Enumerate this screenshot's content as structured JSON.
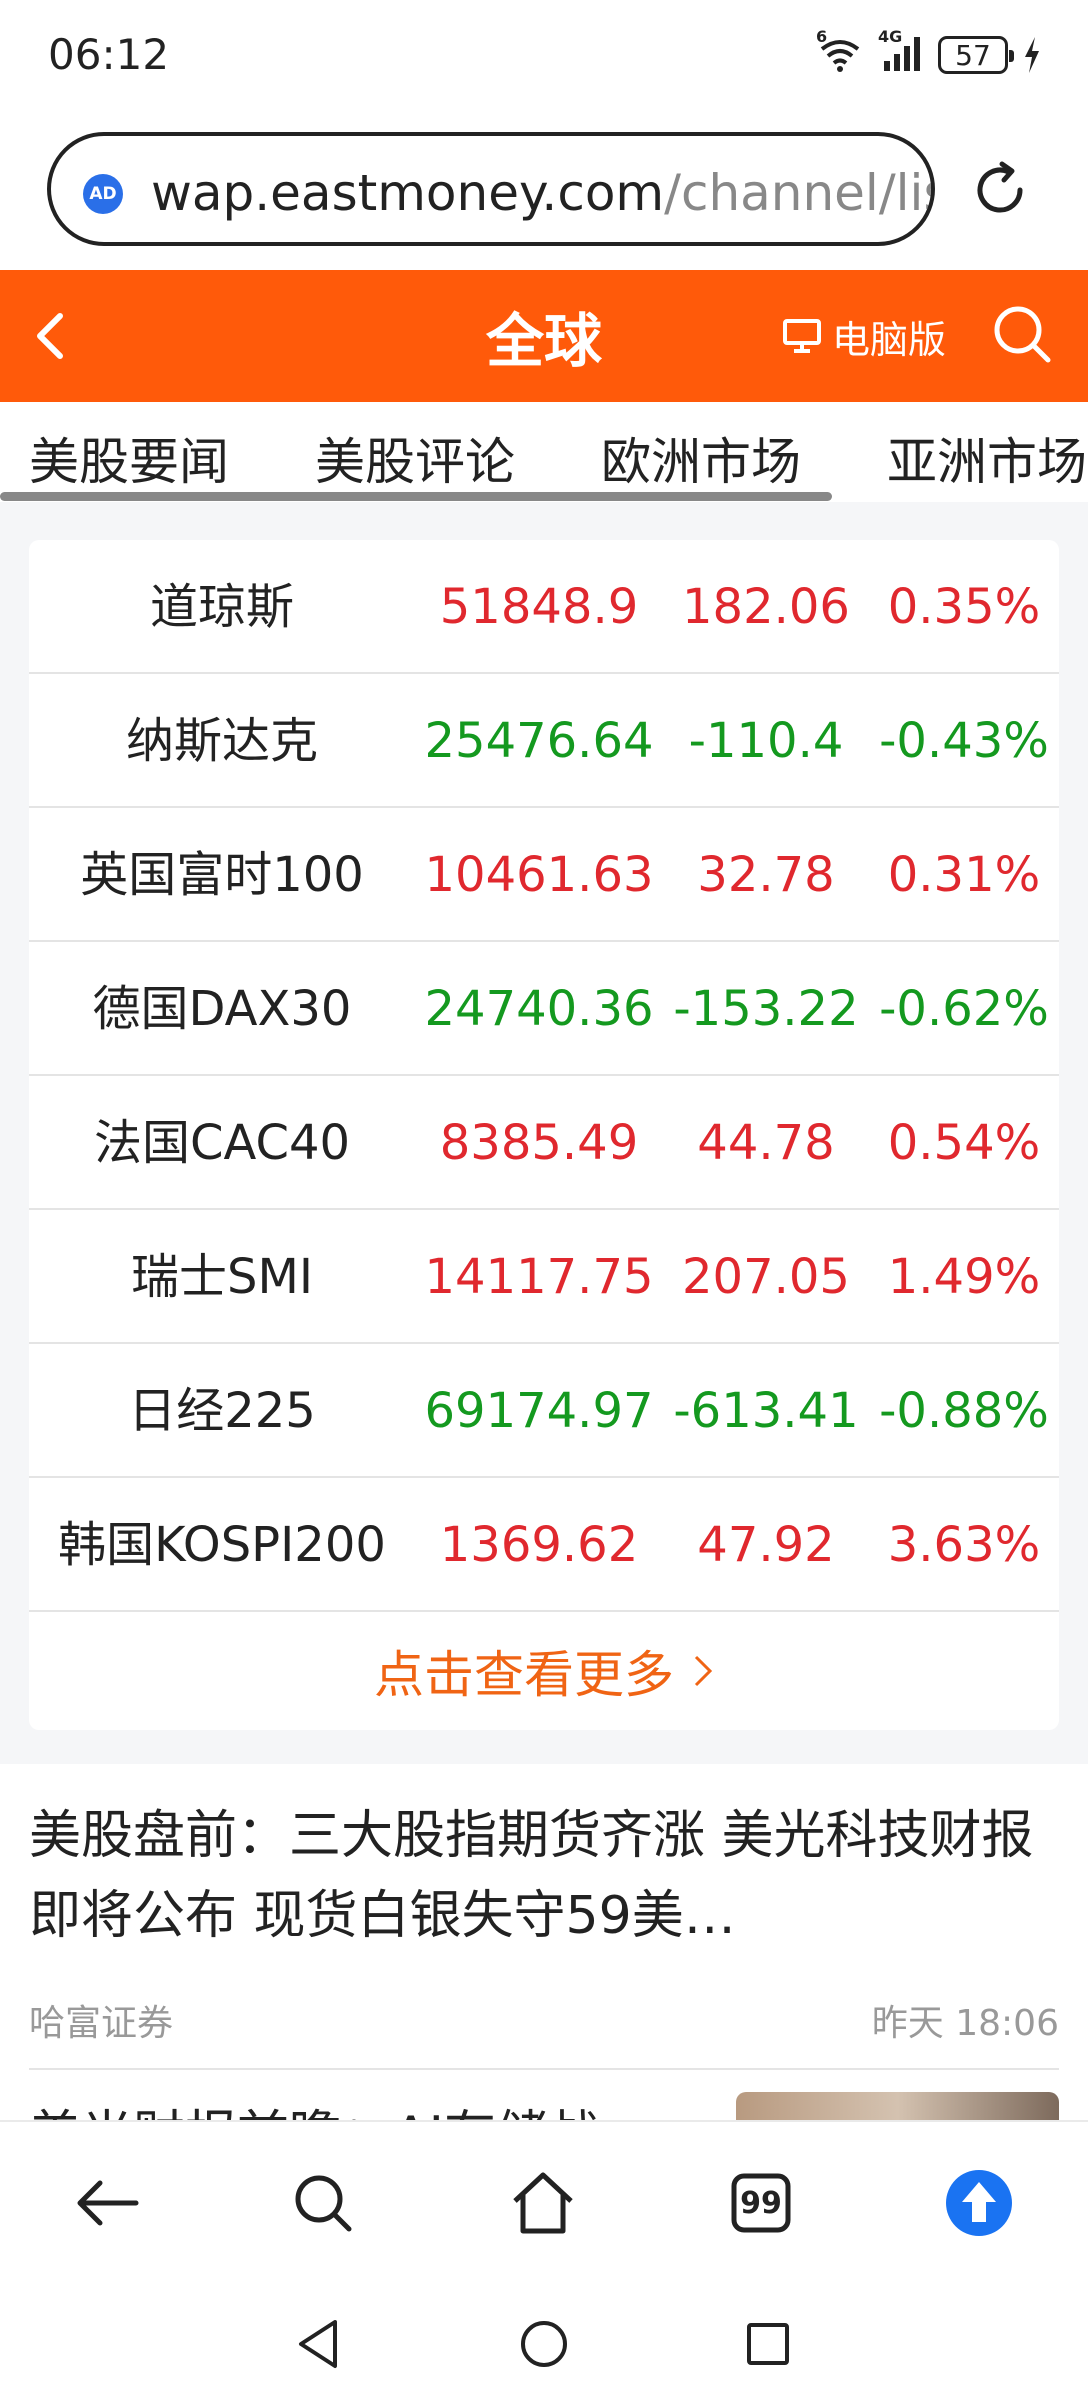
{
  "status_bar": {
    "time": "06:12",
    "wifi_tag": "6",
    "signal_tag": "4G",
    "battery": "57"
  },
  "address_bar": {
    "ad_badge": "AD",
    "url_domain": "wap.eastmoney.com",
    "url_path": "/channel/lis"
  },
  "header": {
    "title": "全球",
    "pc_version_label": "电脑版",
    "background": "#ff5a0a"
  },
  "tabs": [
    "美股要闻",
    "美股评论",
    "欧洲市场",
    "亚洲市场"
  ],
  "indices": [
    {
      "name": "道琼斯",
      "price": "51848.9",
      "change": "182.06",
      "pct": "0.35%",
      "trend": "up"
    },
    {
      "name": "纳斯达克",
      "price": "25476.64",
      "change": "-110.4",
      "pct": "-0.43%",
      "trend": "down"
    },
    {
      "name": "英国富时100",
      "price": "10461.63",
      "change": "32.78",
      "pct": "0.31%",
      "trend": "up"
    },
    {
      "name": "德国DAX30",
      "price": "24740.36",
      "change": "-153.22",
      "pct": "-0.62%",
      "trend": "down"
    },
    {
      "name": "法国CAC40",
      "price": "8385.49",
      "change": "44.78",
      "pct": "0.54%",
      "trend": "up"
    },
    {
      "name": "瑞士SMI",
      "price": "14117.75",
      "change": "207.05",
      "pct": "1.49%",
      "trend": "up"
    },
    {
      "name": "日经225",
      "price": "69174.97",
      "change": "-613.41",
      "pct": "-0.88%",
      "trend": "down"
    },
    {
      "name": "韩国KOSPI200",
      "price": "1369.62",
      "change": "47.92",
      "pct": "3.63%",
      "trend": "up"
    }
  ],
  "more_link": {
    "label": "点击查看更多"
  },
  "news": [
    {
      "title": "美股盘前：三大股指期货齐涨 美光科技财报即将公布 现货白银失守59美…",
      "source": "哈富证券",
      "time": "昨天 18:06"
    }
  ],
  "next_news_peek": "美光财报前瞻：AI存储战",
  "browser_nav": {
    "tab_count": "99"
  },
  "colors": {
    "up": "#e0282e",
    "down": "#14991f",
    "accent": "#f06414",
    "scroll_to_top": "#1a73f2"
  }
}
